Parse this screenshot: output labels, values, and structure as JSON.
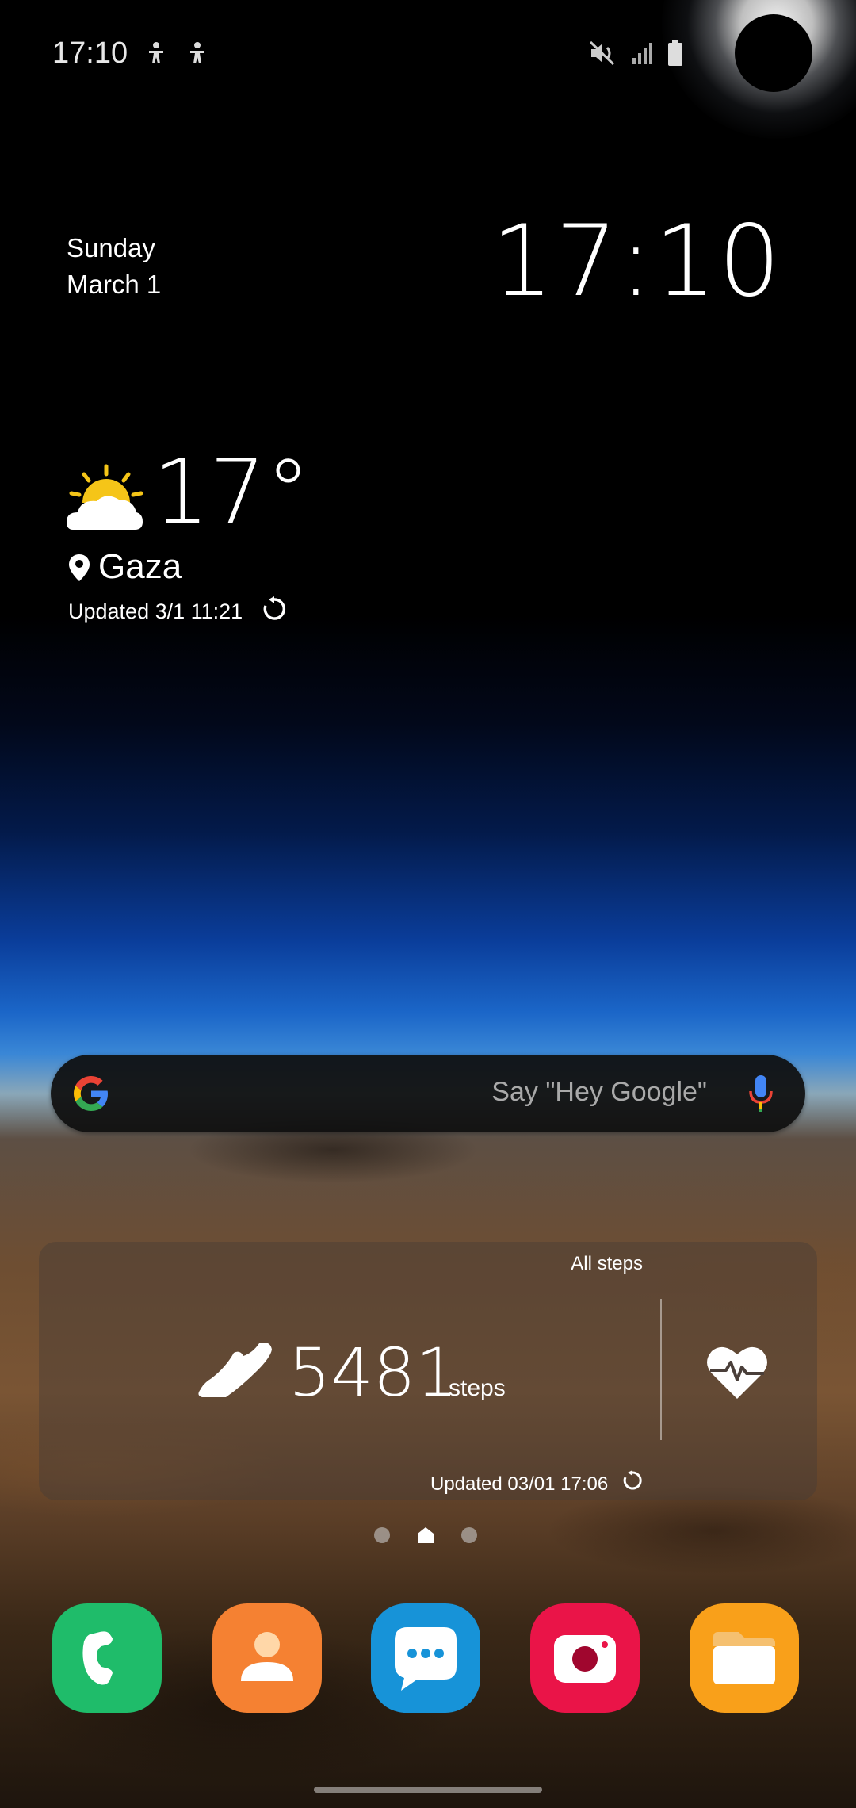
{
  "status_bar": {
    "time": "17:10",
    "left_icons": [
      "accessibility-icon",
      "accessibility-icon"
    ],
    "right_icons": [
      "mute-icon",
      "signal-icon",
      "battery-icon"
    ]
  },
  "clock_widget": {
    "day": "Sunday",
    "date": "March 1",
    "time": "17:10"
  },
  "weather_widget": {
    "temperature": "17°",
    "location": "Gaza",
    "updated": "Updated 3/1 11:21",
    "icon": "partly-cloudy-icon"
  },
  "search_bar": {
    "hint": "Say \"Hey Google\""
  },
  "steps_widget": {
    "filter_label": "All steps",
    "count": "5481",
    "unit": "steps",
    "updated": "Updated 03/01 17:06"
  },
  "page_indicator": {
    "pages": 3,
    "current": 1
  },
  "dock": {
    "apps": [
      "Phone",
      "Contacts",
      "Messages",
      "Camera",
      "My Files"
    ],
    "colors": {
      "phone": "#1fbc6a",
      "contacts": "#f58132",
      "messages": "#1793d8",
      "camera": "#ea1448",
      "files": "#f9a01a"
    }
  }
}
